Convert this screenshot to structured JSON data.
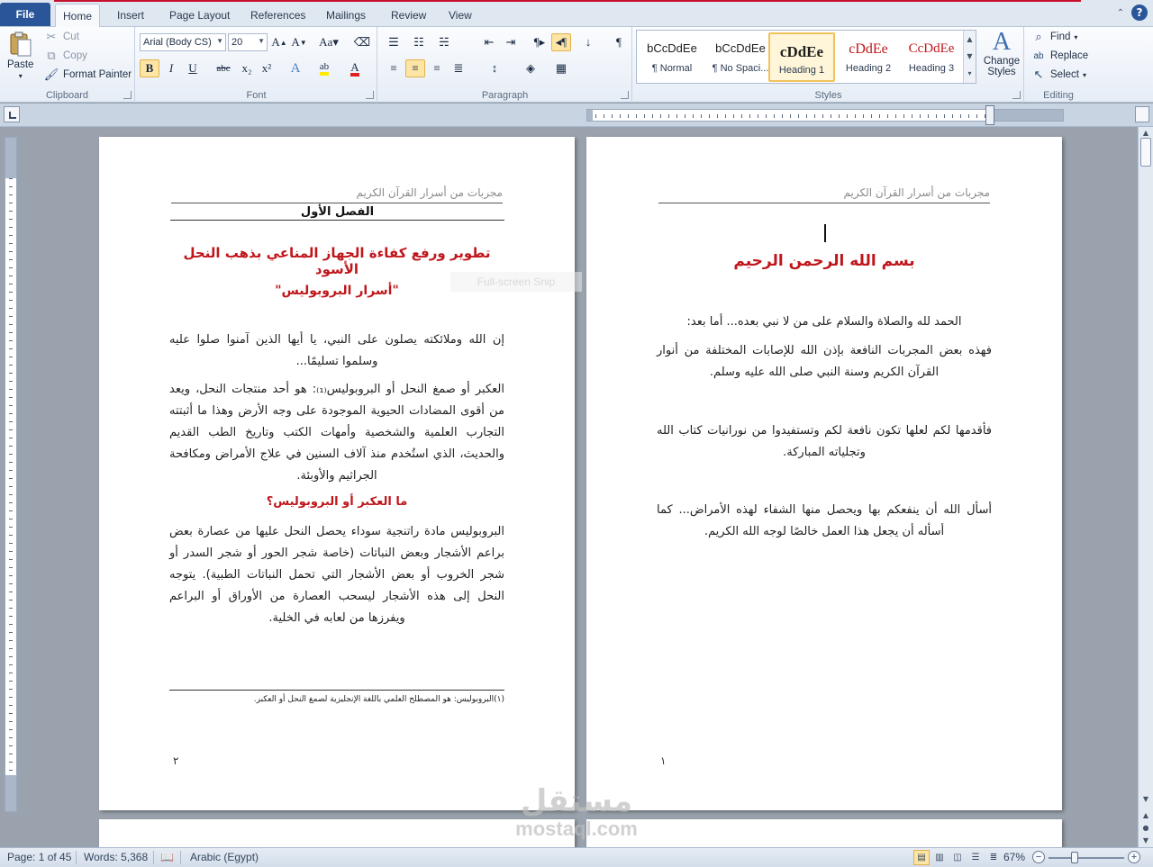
{
  "ribbon_tabs": [
    "File",
    "Home",
    "Insert",
    "Page Layout",
    "References",
    "Mailings",
    "Review",
    "View"
  ],
  "clipboard": {
    "paste": "Paste",
    "cut": "Cut",
    "copy": "Copy",
    "format_painter": "Format Painter",
    "label": "Clipboard"
  },
  "font": {
    "name": "Arial (Body CS)",
    "size": "20",
    "label": "Font",
    "buttons": [
      "B",
      "I",
      "U",
      "abc",
      "x₂",
      "x²"
    ]
  },
  "paragraph": {
    "label": "Paragraph"
  },
  "styles": {
    "label": "Styles",
    "items": [
      {
        "sample": "bCcDdEe",
        "name": "¶ Normal"
      },
      {
        "sample": "bCcDdEe",
        "name": "¶ No Spaci..."
      },
      {
        "sample": "cDdEe",
        "name": "Heading 1"
      },
      {
        "sample": "cDdEe",
        "name": "Heading 2"
      },
      {
        "sample": "CcDdEe",
        "name": "Heading 3"
      }
    ],
    "change_styles": "Change Styles"
  },
  "editing": {
    "find": "Find",
    "replace": "Replace",
    "select": "Select",
    "label": "Editing"
  },
  "colors": {
    "accent": "#2a5699",
    "heading_red": "#c0161b",
    "highlight": "#fde5a5"
  },
  "page_right": {
    "header": "مجربات من أسرار القرآن الكريم",
    "basmala": "بسم الله الرحمن الرحيم",
    "p1": "الحمد لله والصلاة والسلام على من لا نبي بعده... أما بعد:",
    "p2": "فهذه بعض المجربات النافعة بإذن الله للإصابات المختلفة من أنوار القرآن الكريم وسنة النبي صلى الله عليه وسلم.",
    "p3": "فأقدمها لكم لعلها تكون نافعة لكم وتستفيدوا من نورانيات كتاب الله وتجلياته المباركة.",
    "p4": "أسأل الله أن ينفعكم بها ويحصل منها الشفاء لهذه الأمراض... كما أسأله أن يجعل هذا العمل خالصًا لوجه الله الكريم.",
    "page_number": "١"
  },
  "page_left": {
    "header": "مجربات من أسرار القرآن الكريم",
    "chapter": "الفصل الأول",
    "title": "تطوير ورفع كفاءة الجهاز المناعي بذهب النحل الأسود",
    "subtitle": "\"أسرار البروبوليس\"",
    "p1": "إن الله وملائكته يصلون على النبي، يا أيها الذين آمنوا صلوا عليه وسلموا تسليمًا...",
    "p2": "العكبر أو صمغ النحل أو البروبوليس₍₁₎: هو أحد منتجات النحل، ويعد من أقوى المضادات الحيوية الموجودة على وجه الأرض وهذا ما أثبتته التجارب العلمية والشخصية وأمهات الكتب وتاريخ الطب القديم والحديث، الذي استُخدم منذ آلاف السنين في علاج الأمراض ومكافحة الجراثيم والأوبئة.",
    "q_heading": "ما العكبر أو البروبوليس؟",
    "p3": "البروبوليس مادة راتنجية سوداء يحصل النحل عليها من عصارة بعض براعم الأشجار وبعض النباتات (خاصة شجر الحور أو شجر السدر أو شجر الخروب أو بعض الأشجار التي تحمل النباتات الطبية). يتوجه النحل إلى هذه الأشجار ليسحب العصارة من الأوراق أو البراعم ويفرزها من لعابه في الخلية.",
    "footnote": "(١)البروبوليس: هو المصطلح العلمي باللغة الإنجليزية لصمغ النحل أو العكبر.",
    "page_number": "٢"
  },
  "snip_overlay": "Full-screen Snip",
  "watermark": {
    "arabic": "مستقل",
    "latin": "mostaql.com"
  },
  "statusbar": {
    "page": "Page: 1 of 45",
    "words": "Words: 5,368",
    "language": "Arabic (Egypt)",
    "zoom": "67%",
    "zoom_percent": 67
  }
}
